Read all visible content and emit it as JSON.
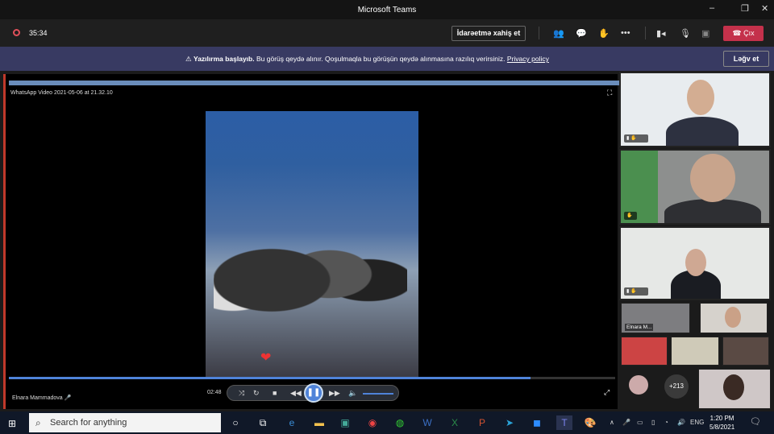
{
  "window": {
    "title": "Microsoft Teams",
    "controls": [
      "–",
      "❐",
      "✕"
    ]
  },
  "toolbar": {
    "timer": "35:34",
    "request_control": "İdarəetmə xahiş et",
    "icons": [
      "participants-icon",
      "chat-icon",
      "reactions-icon",
      "more-icon",
      "camera-icon",
      "mic-off-icon",
      "share-icon"
    ],
    "leave": "Çıx"
  },
  "banner": {
    "bold": "Yazılırma başlayıb.",
    "text": "Bu görüş qeydə alınır. Qoşulmaqla bu görüşün qeydə alınmasına razılıq verirsiniz.",
    "link": "Privacy policy",
    "dismiss": "Ləğv et"
  },
  "stage": {
    "video_title": "WhatsApp Video 2021-05-06 at 21.32.10",
    "player": {
      "time": "02:48",
      "progress": 0.86,
      "volume": 0.7
    },
    "presenter": "Elnara Mammadova"
  },
  "participants": {
    "small_label": "Elnara M...",
    "overflow": "+213"
  },
  "taskbar": {
    "search_placeholder": "Search for anything",
    "lang": "ENG",
    "time": "1:20 PM",
    "date": "5/8/2021"
  },
  "colors": {
    "accent": "#4f83d9",
    "leave": "#c4314b",
    "banner": "#383a62"
  }
}
